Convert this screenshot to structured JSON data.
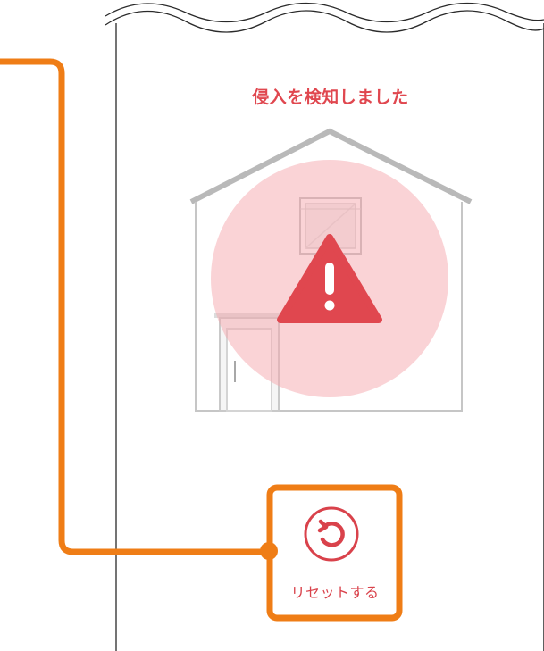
{
  "alert": {
    "title": "侵入を検知しました",
    "color": "#e0474f",
    "icon": "warning-triangle-icon"
  },
  "reset_button": {
    "label": "リセットする",
    "icon": "reset-rotate-icon",
    "color": "#d9424b"
  },
  "callout": {
    "color": "#ef7d16"
  }
}
